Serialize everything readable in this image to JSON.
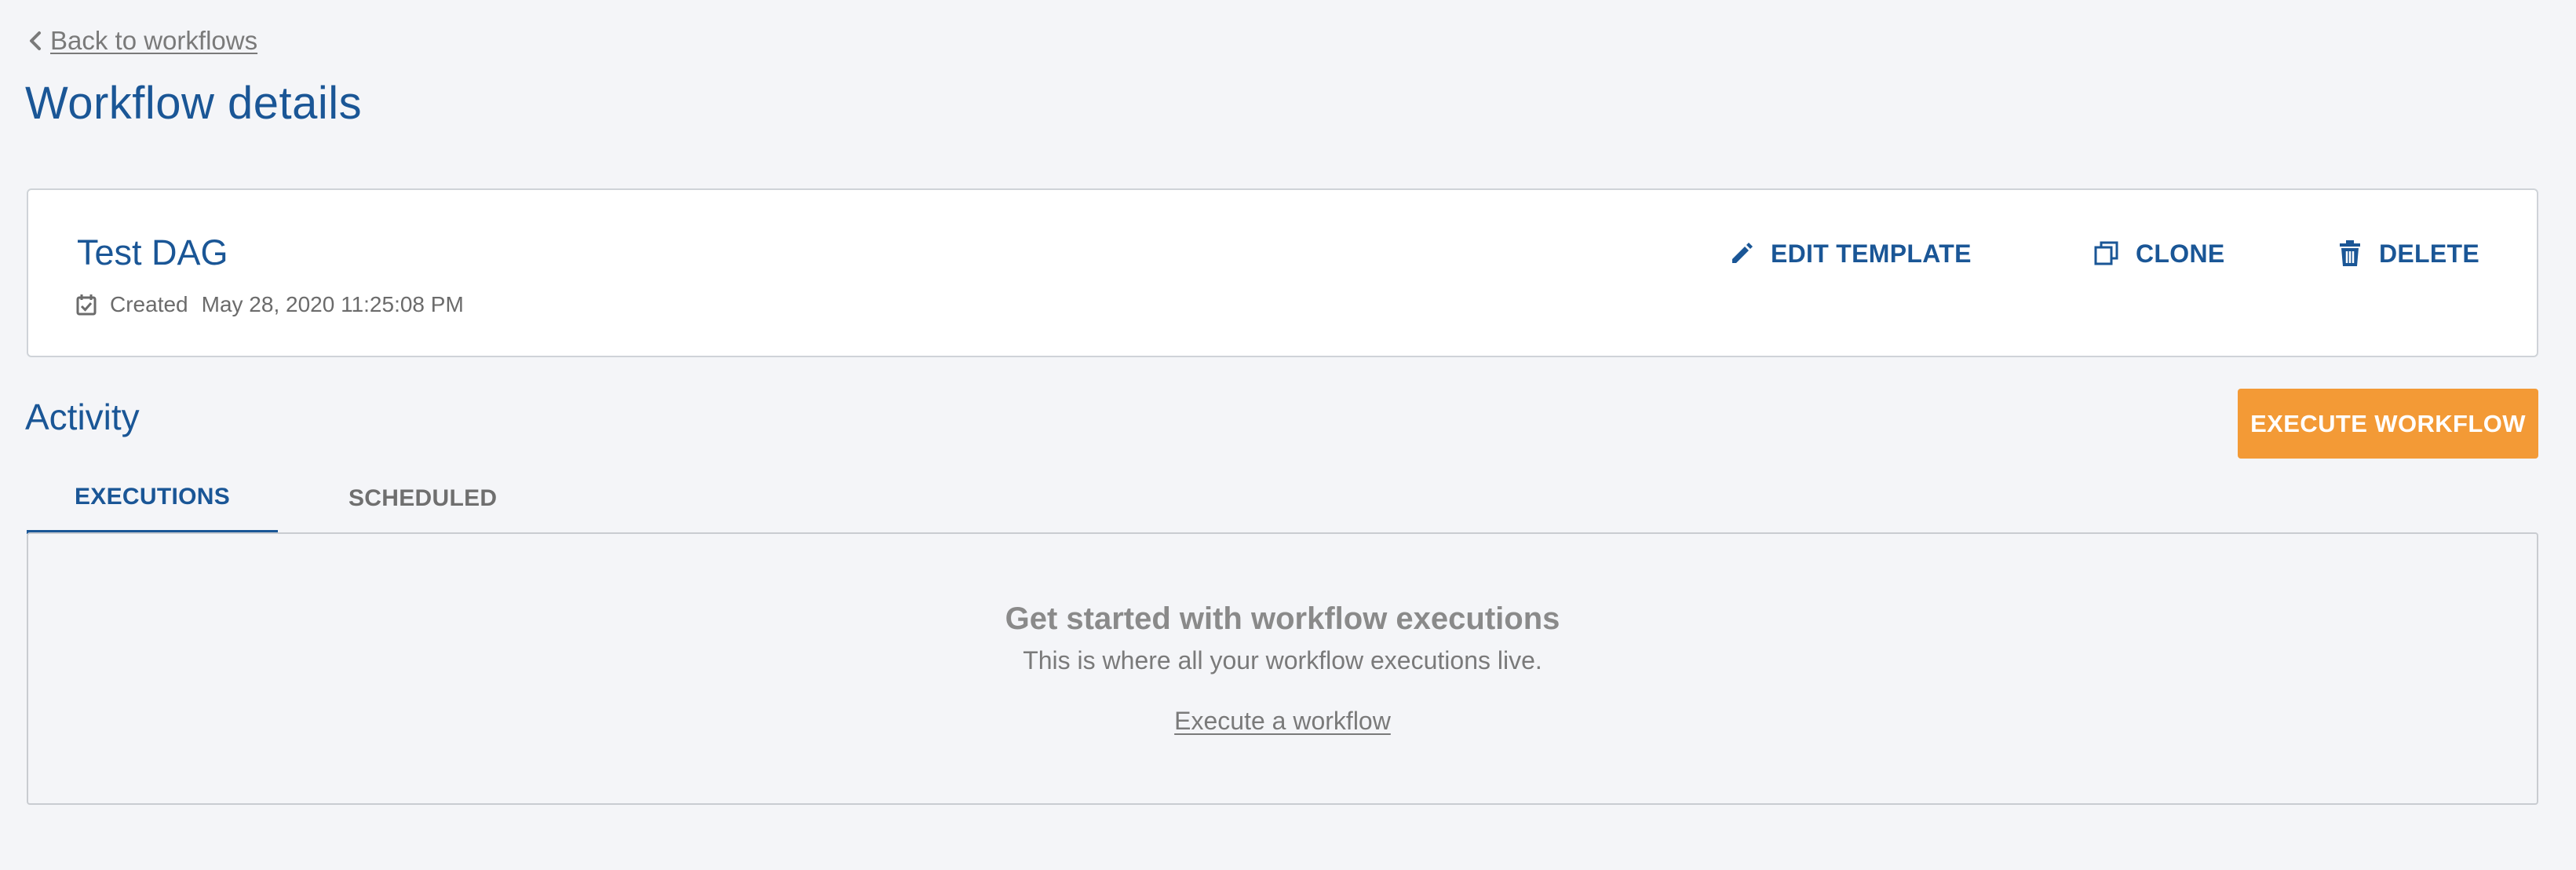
{
  "nav": {
    "back_label": "Back to workflows",
    "back_icon": "chevron-left-icon"
  },
  "page": {
    "title": "Workflow details"
  },
  "workflow": {
    "name": "Test DAG",
    "created_label": "Created",
    "created_value": "May 28, 2020 11:25:08 PM",
    "created_icon": "calendar-check-icon"
  },
  "actions": {
    "edit_template": {
      "label": "EDIT TEMPLATE",
      "icon": "pencil-icon"
    },
    "clone": {
      "label": "CLONE",
      "icon": "copy-icon"
    },
    "delete": {
      "label": "DELETE",
      "icon": "trash-icon"
    }
  },
  "activity": {
    "title": "Activity",
    "execute_button": "EXECUTE WORKFLOW",
    "tabs": [
      {
        "label": "EXECUTIONS",
        "active": true
      },
      {
        "label": "SCHEDULED",
        "active": false
      }
    ],
    "empty_state": {
      "heading": "Get started with workflow executions",
      "subtext": "This is where all your workflow executions live.",
      "link": "Execute a workflow"
    }
  },
  "colors": {
    "primary": "#1a5696",
    "accent": "#f39a36",
    "background": "#f4f5f8",
    "muted_text": "#7a7a7a"
  }
}
